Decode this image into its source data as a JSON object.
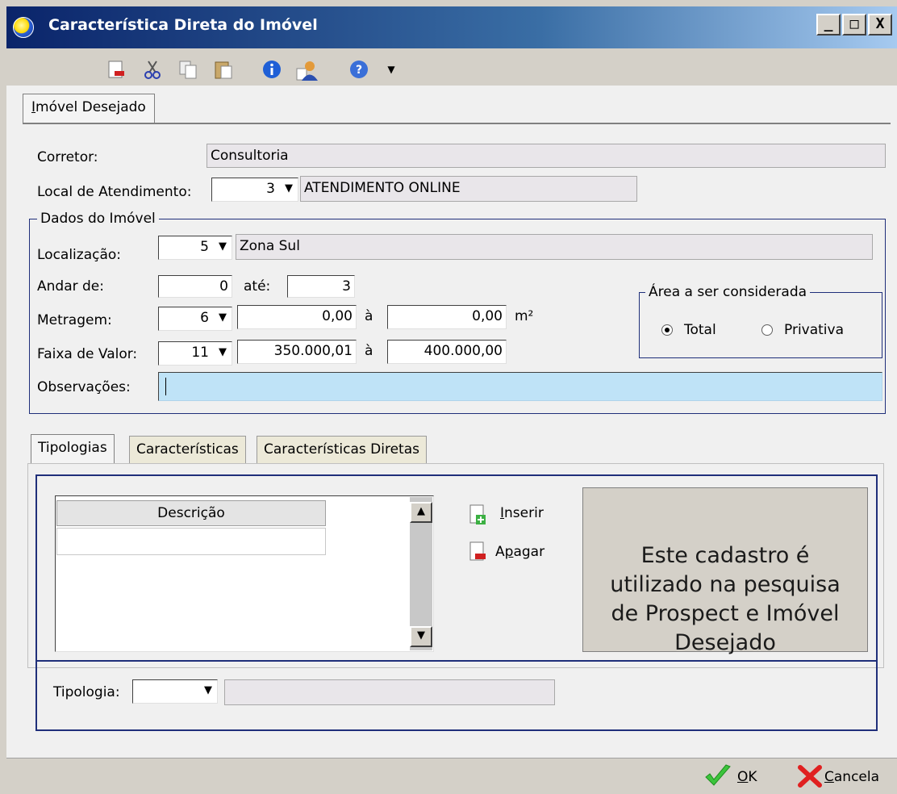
{
  "window": {
    "title": "Característica Direta do Imóvel",
    "minimize": "_",
    "maximize": "□",
    "close": "X"
  },
  "toolbar": {
    "icons": [
      "new-doc-icon",
      "cut-icon",
      "copy-icon",
      "paste-icon",
      "info-icon",
      "user-icon",
      "help-icon",
      "dropdown-arrow-icon"
    ]
  },
  "main_tab": {
    "label_first": "I",
    "label_rest": "móvel Desejado"
  },
  "form": {
    "corretor_label": "Corretor:",
    "corretor_value": "Consultoria",
    "local_label": "Local de Atendimento:",
    "local_code": "3",
    "local_value": "ATENDIMENTO ONLINE"
  },
  "dados": {
    "title": "Dados do Imóvel",
    "localizacao_label": "Localização:",
    "localizacao_code": "5",
    "localizacao_value": "Zona Sul",
    "andar_label": "Andar de:",
    "andar_de": "0",
    "ate_label": "até:",
    "andar_ate": "3",
    "metragem_label": "Metragem:",
    "metragem_code": "6",
    "metragem_de": "0,00",
    "metragem_a_label": "à",
    "metragem_ate": "0,00",
    "metragem_unit": "m²",
    "faixa_label": "Faixa de Valor:",
    "faixa_code": "11",
    "faixa_de": "350.000,01",
    "faixa_a_label": "à",
    "faixa_ate": "400.000,00",
    "obs_label": "Observações:",
    "obs_value": ""
  },
  "area": {
    "title": "Área a ser considerada",
    "option_total": "Total",
    "option_privativa": "Privativa",
    "selected": "Total"
  },
  "sub_tabs": [
    "Tipologias",
    "Características",
    "Características Diretas"
  ],
  "tipologias": {
    "column_header": "Descrição",
    "inserir_first": "I",
    "inserir_rest": "nserir",
    "apagar_first": "A",
    "apagar_mid": "p",
    "apagar_rest": "agar",
    "tipologia_label": "Tipologia:",
    "tipologia_value": "",
    "info_text": "Este cadastro é utilizado na pesquisa de Prospect e Imóvel Desejado"
  },
  "buttons": {
    "ok_first": "O",
    "ok_rest": "K",
    "cancel_first": "C",
    "cancel_rest": "ancela"
  },
  "colors": {
    "title_bar": "#0a246a",
    "border_blue": "#1f2f7a",
    "obs_bg": "#bfe3f7"
  }
}
